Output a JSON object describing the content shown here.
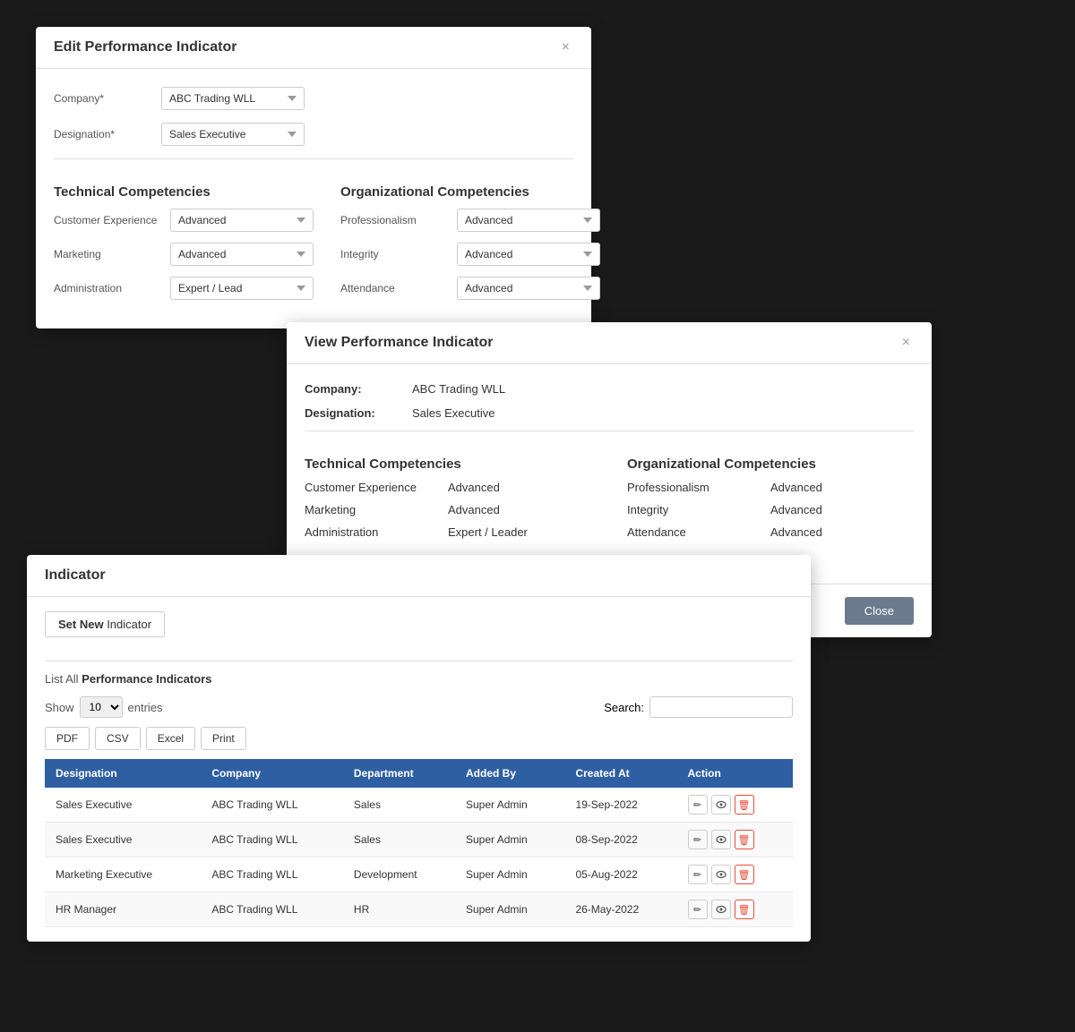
{
  "editModal": {
    "title": "Edit Performance Indicator",
    "company_label": "Company*",
    "company_value": "ABC Trading WLL",
    "designation_label": "Designation*",
    "designation_value": "Sales Executive",
    "technical_title": "Technical Competencies",
    "organizational_title": "Organizational Competencies",
    "technical_rows": [
      {
        "label": "Customer Experience",
        "value": "Advanced"
      },
      {
        "label": "Marketing",
        "value": "Advanced"
      },
      {
        "label": "Administration",
        "value": "Expert / Lead"
      }
    ],
    "organizational_rows": [
      {
        "label": "Professionalism",
        "value": "Advanced"
      },
      {
        "label": "Integrity",
        "value": "Advanced"
      },
      {
        "label": "Attendance",
        "value": "Advanced"
      }
    ],
    "close_label": "×"
  },
  "viewModal": {
    "title": "View Performance Indicator",
    "company_label": "Company:",
    "company_value": "ABC Trading WLL",
    "designation_label": "Designation:",
    "designation_value": "Sales Executive",
    "technical_title": "Technical Competencies",
    "organizational_title": "Organizational Competencies",
    "technical_rows": [
      {
        "label": "Customer Experience",
        "value": "Advanced"
      },
      {
        "label": "Marketing",
        "value": "Advanced"
      },
      {
        "label": "Administration",
        "value": "Expert / Leader"
      }
    ],
    "organizational_rows": [
      {
        "label": "Professionalism",
        "value": "Advanced"
      },
      {
        "label": "Integrity",
        "value": "Advanced"
      },
      {
        "label": "Attendance",
        "value": "Advanced"
      }
    ],
    "close_btn": "Close",
    "close_label": "×"
  },
  "listPanel": {
    "title": "Indicator",
    "set_new_label": "Set New",
    "set_new_suffix": " Indicator",
    "list_all_prefix": "List All",
    "list_all_suffix": " Performance Indicators",
    "show_label": "Show",
    "entries_value": "10",
    "entries_label": "entries",
    "search_label": "Search:",
    "export_btns": [
      "PDF",
      "CSV",
      "Excel",
      "Print"
    ],
    "table_headers": [
      "Designation",
      "Company",
      "Department",
      "Added By",
      "Created At",
      "Action"
    ],
    "table_rows": [
      {
        "designation": "Sales Executive",
        "company": "ABC Trading WLL",
        "department": "Sales",
        "added_by": "Super Admin",
        "created_at": "19-Sep-2022"
      },
      {
        "designation": "Sales Executive",
        "company": "ABC Trading WLL",
        "department": "Sales",
        "added_by": "Super Admin",
        "created_at": "08-Sep-2022"
      },
      {
        "designation": "Marketing Executive",
        "company": "ABC Trading WLL",
        "department": "Development",
        "added_by": "Super Admin",
        "created_at": "05-Aug-2022"
      },
      {
        "designation": "HR Manager",
        "company": "ABC Trading WLL",
        "department": "HR",
        "added_by": "Super Admin",
        "created_at": "26-May-2022"
      }
    ]
  },
  "icons": {
    "edit": "✏",
    "view": "👁",
    "delete": "🗑",
    "dropdown_arrow": "▼"
  }
}
